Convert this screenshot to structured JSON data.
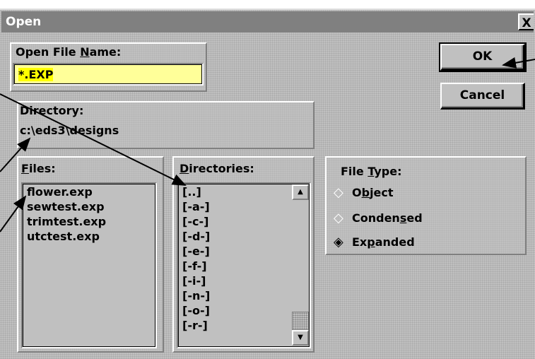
{
  "titlebar": {
    "title": "Open",
    "close_label": "X"
  },
  "filename": {
    "label_prefix": "Open File ",
    "label_mnemonic": "N",
    "label_suffix": "ame:",
    "value": "*.EXP"
  },
  "buttons": {
    "ok": "OK",
    "cancel": "Cancel"
  },
  "directory": {
    "label": "Directory:",
    "path": "c:\\eds3\\designs"
  },
  "files": {
    "label_mnemonic": "F",
    "label_suffix": "iles:",
    "items": [
      "flower.exp",
      "sewtest.exp",
      "trimtest.exp",
      "utctest.exp"
    ]
  },
  "directories": {
    "label_mnemonic": "D",
    "label_suffix": "irectories:",
    "items": [
      "[..]",
      "[-a-]",
      "[-c-]",
      "[-d-]",
      "[-e-]",
      "[-f-]",
      "[-i-]",
      "[-n-]",
      "[-o-]",
      "[-r-]"
    ]
  },
  "file_type": {
    "label_prefix": "File ",
    "label_mnemonic": "T",
    "label_suffix": "ype:",
    "options": [
      {
        "pre": "O",
        "mn": "b",
        "post": "ject",
        "selected": false
      },
      {
        "pre": "Conden",
        "mn": "s",
        "post": "ed",
        "selected": false
      },
      {
        "pre": "Ex",
        "mn": "p",
        "post": "anded",
        "selected": true
      }
    ]
  },
  "colors": {
    "titlebar": "#808080",
    "face": "#c0c0c0",
    "input_bg": "#ffff99",
    "selection": "#ffff00"
  },
  "icons": {
    "close": "close-icon",
    "scroll_up": "arrow-up-icon",
    "scroll_down": "arrow-down-icon",
    "radio": "diamond-radio-icon"
  }
}
